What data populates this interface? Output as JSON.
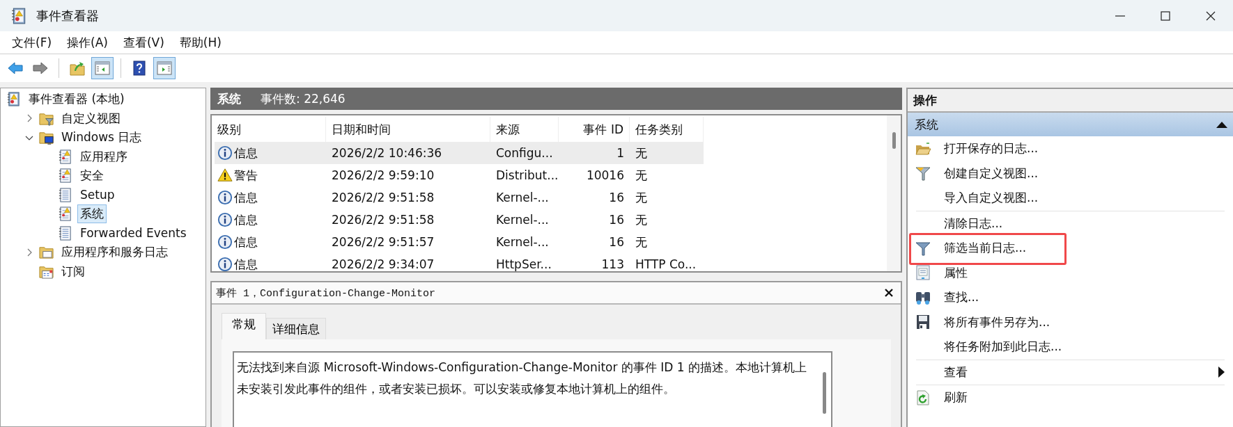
{
  "window": {
    "title": "事件查看器"
  },
  "menu": [
    {
      "label": "文件(F)"
    },
    {
      "label": "操作(A)"
    },
    {
      "label": "查看(V)"
    },
    {
      "label": "帮助(H)"
    }
  ],
  "toolbar": [
    {
      "kind": "back"
    },
    {
      "kind": "forward"
    },
    {
      "kind": "separator"
    },
    {
      "kind": "up"
    },
    {
      "kind": "pane-left",
      "on": true
    },
    {
      "kind": "separator"
    },
    {
      "kind": "help"
    },
    {
      "kind": "pane-right",
      "on": true
    }
  ],
  "tree": [
    {
      "label": "事件查看器 (本地)",
      "kind": "log-root",
      "selected": false,
      "children": [
        {
          "label": "自定义视图",
          "kind": "folder-filter",
          "selected": false,
          "expanded": false
        },
        {
          "label": "Windows 日志",
          "kind": "folder-windows",
          "selected": false,
          "expanded": true,
          "children": [
            {
              "label": "应用程序",
              "kind": "log-warning",
              "selected": false
            },
            {
              "label": "安全",
              "kind": "log-warning",
              "selected": false
            },
            {
              "label": "Setup",
              "kind": "log",
              "selected": false
            },
            {
              "label": "系统",
              "kind": "log-warning",
              "selected": true
            },
            {
              "label": "Forwarded Events",
              "kind": "log",
              "selected": false
            }
          ]
        },
        {
          "label": "应用程序和服务日志",
          "kind": "folder",
          "selected": false,
          "expanded": false
        },
        {
          "label": "订阅",
          "kind": "folder-subscription",
          "selected": false
        }
      ]
    }
  ],
  "log_header": {
    "title": "系统",
    "count": "事件数: 22,646"
  },
  "table": {
    "columns": [
      "级别",
      "日期和时间",
      "来源",
      "事件 ID",
      "任务类别"
    ],
    "rows": [
      {
        "kind": "info",
        "selected": true,
        "cells": [
          "信息",
          "2026/2/2 10:46:36",
          "Configu...",
          "1",
          "无"
        ]
      },
      {
        "kind": "warning",
        "selected": false,
        "cells": [
          "警告",
          "2026/2/2 9:59:10",
          "Distribut...",
          "10016",
          "无"
        ]
      },
      {
        "kind": "info",
        "selected": false,
        "cells": [
          "信息",
          "2026/2/2 9:51:58",
          "Kernel-...",
          "16",
          "无"
        ]
      },
      {
        "kind": "info",
        "selected": false,
        "cells": [
          "信息",
          "2026/2/2 9:51:58",
          "Kernel-...",
          "16",
          "无"
        ]
      },
      {
        "kind": "info",
        "selected": false,
        "cells": [
          "信息",
          "2026/2/2 9:51:57",
          "Kernel-...",
          "16",
          "无"
        ]
      },
      {
        "kind": "info",
        "selected": false,
        "cells": [
          "信息",
          "2026/2/2 9:34:07",
          "HttpSer...",
          "113",
          "HTTP Co..."
        ]
      }
    ]
  },
  "detail": {
    "title": "事件 1，Configuration-Change-Monitor",
    "tabs": [
      {
        "label": "常规",
        "selected": true
      },
      {
        "label": "详细信息",
        "selected": false
      }
    ],
    "description": "无法找到来自源 Microsoft-Windows-Configuration-Change-Monitor 的事件 ID 1 的描述。本地计算机上未安装引发此事件的组件，或者安装已损坏。可以安装或修复本地计算机上的组件。"
  },
  "actions": {
    "title": "操作",
    "section": {
      "title": "系统",
      "expanded": true
    },
    "items": [
      {
        "label": "打开保存的日志...",
        "kind": "open-folder"
      },
      {
        "label": "创建自定义视图...",
        "kind": "filter-gold"
      },
      {
        "label": "导入自定义视图..."
      },
      {
        "label": "清除日志...",
        "divider_above": true
      },
      {
        "label": "筛选当前日志...",
        "kind": "filter-blue",
        "highlighted": true
      },
      {
        "label": "属性",
        "kind": "properties"
      },
      {
        "label": "查找...",
        "kind": "binoculars"
      },
      {
        "label": "将所有事件另存为...",
        "kind": "save"
      },
      {
        "label": "将任务附加到此日志..."
      },
      {
        "label": "查看",
        "divider_above": true,
        "submenu": true
      },
      {
        "label": "刷新",
        "kind": "refresh",
        "divider_above": true
      }
    ]
  }
}
